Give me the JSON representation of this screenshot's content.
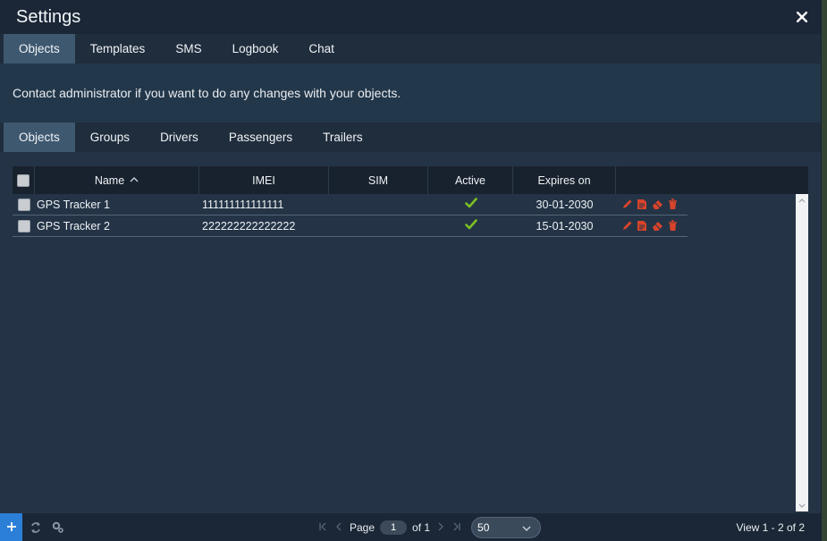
{
  "window": {
    "title": "Settings"
  },
  "main_tabs": [
    "Objects",
    "Templates",
    "SMS",
    "Logbook",
    "Chat"
  ],
  "main_tab_active": "Objects",
  "info_message": "Contact administrator if you want to do any changes with your objects.",
  "sub_tabs": [
    "Objects",
    "Groups",
    "Drivers",
    "Passengers",
    "Trailers"
  ],
  "sub_tab_active": "Objects",
  "grid": {
    "columns": {
      "name": "Name",
      "imei": "IMEI",
      "sim": "SIM",
      "active": "Active",
      "expires": "Expires on"
    },
    "sort_column": "Name",
    "rows": [
      {
        "name": "GPS Tracker 1",
        "imei": "111111111111111",
        "sim": "",
        "active": true,
        "expires": "30-01-2030"
      },
      {
        "name": "GPS Tracker 2",
        "imei": "222222222222222",
        "sim": "",
        "active": true,
        "expires": "15-01-2030"
      }
    ]
  },
  "footer": {
    "page_label": "Page",
    "page_value": "1",
    "of_label": "of 1",
    "per_page": "50",
    "view_info": "View 1 - 2 of 2"
  },
  "colors": {
    "accent": "#2b7fd6",
    "active_tab": "#3e5870",
    "action_icons": "#d9432b",
    "check": "#7cc121"
  },
  "icons": [
    "close-icon",
    "sort-asc-icon",
    "check-icon",
    "edit-icon",
    "document-icon",
    "eraser-icon",
    "trash-icon",
    "plus-icon",
    "refresh-icon",
    "settings-icon"
  ]
}
